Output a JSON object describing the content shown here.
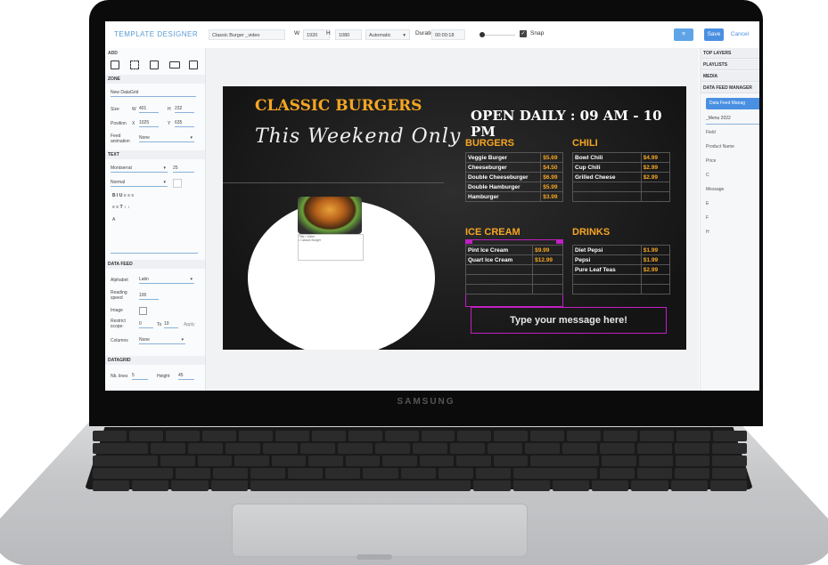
{
  "device": {
    "brand": "SAMSUNG"
  },
  "toolbar": {
    "app_title": "TEMPLATE DESIGNER",
    "template_name": "Classic Burger _video",
    "width_label": "W",
    "width_value": "1920",
    "height_label": "H",
    "height_value": "1080",
    "mode_value": "Automatic",
    "duration_label": "Duration",
    "duration_value": "00:00:18",
    "snap_label": "Snap",
    "list_button": "≡",
    "save_label": "Save",
    "cancel_label": "Cancel"
  },
  "left_panel": {
    "add_label": "ADD",
    "zone_label": "ZONE",
    "zone_name": "New DataGrid",
    "size_label": "Size",
    "size_w_label": "W",
    "size_w": "401",
    "size_h_label": "H",
    "size_h": "232",
    "position_label": "Position",
    "pos_x_label": "X",
    "pos_x": "1025",
    "pos_y_label": "Y",
    "pos_y": "635",
    "feed_animation_label": "Feed animation",
    "feed_animation_value": "None",
    "text_label": "TEXT",
    "font_value": "Montserrat",
    "font_size": "25",
    "weight_value": "Normal",
    "format_row1": "B  I  U    ≡  ≡  ≡",
    "format_row2": "≡  ≡    T  ↕  ↓",
    "text_a": "A",
    "data_feed_label": "DATA FEED",
    "alphabet_label": "Alphabet",
    "alphabet_value": "Latin",
    "reading_speed_label": "Reading speed",
    "reading_speed_value": "100",
    "image_label": "Image",
    "restrict_label": "Restrict scope:",
    "restrict_from": "0",
    "restrict_to_label": "To",
    "restrict_to": "10",
    "apply_label": "Apply",
    "columns_label": "Columns",
    "columns_value": "None",
    "datagrid_label": "DATAGRID",
    "nb_lines_label": "Nb. lines",
    "nb_lines_value": "5",
    "height_label": "Height",
    "height_value": "45"
  },
  "board": {
    "title": "CLASSIC BURGERS",
    "subtitle": "This Weekend Only",
    "hours": "OPEN DAILY : 09 AM - 10 PM",
    "card_caption_line1": "Title | Video",
    "card_caption_line2": "• Classic Burger",
    "message": "Type your message here!",
    "sections": {
      "burgers": {
        "title": "BURGERS",
        "rows": [
          [
            "Veggie Burger",
            "$5.69"
          ],
          [
            "Cheeseburger",
            "$4.50"
          ],
          [
            "Double Cheeseburger",
            "$6.99"
          ],
          [
            "Double Hamburger",
            "$5.99"
          ],
          [
            "Hamburger",
            "$3.99"
          ]
        ]
      },
      "chili": {
        "title": "CHILI",
        "rows": [
          [
            "Bowl Chili",
            "$4.99"
          ],
          [
            "Cup Chili",
            "$2.99"
          ],
          [
            "Grilled Cheese",
            "$2.99"
          ],
          [
            "",
            ""
          ],
          [
            "",
            ""
          ]
        ]
      },
      "ice_cream": {
        "title": "ICE CREAM",
        "rows": [
          [
            "Pint Ice Cream",
            "$9.99"
          ],
          [
            "Quart Ice Cream",
            "$12.99"
          ],
          [
            "",
            ""
          ],
          [
            "",
            ""
          ],
          [
            "",
            ""
          ]
        ]
      },
      "drinks": {
        "title": "DRINKS",
        "rows": [
          [
            "Diet Pepsi",
            "$1.99"
          ],
          [
            "Pepsi",
            "$1.99"
          ],
          [
            "Pure Leaf Teas",
            "$2.99"
          ],
          [
            "",
            ""
          ],
          [
            "",
            ""
          ]
        ]
      }
    }
  },
  "right_panel": {
    "top_layers": "TOP LAYERS",
    "playlists": "PLAYLISTS",
    "media": "MEDIA",
    "data_feed_manager": "DATA FEED MANAGER",
    "dfm_button": "Data Feed Manag",
    "feed_name": "_Menu 2022",
    "fields": [
      "Field",
      "Product Name",
      "Price",
      "C",
      "Message",
      "E",
      "F",
      "H"
    ]
  }
}
